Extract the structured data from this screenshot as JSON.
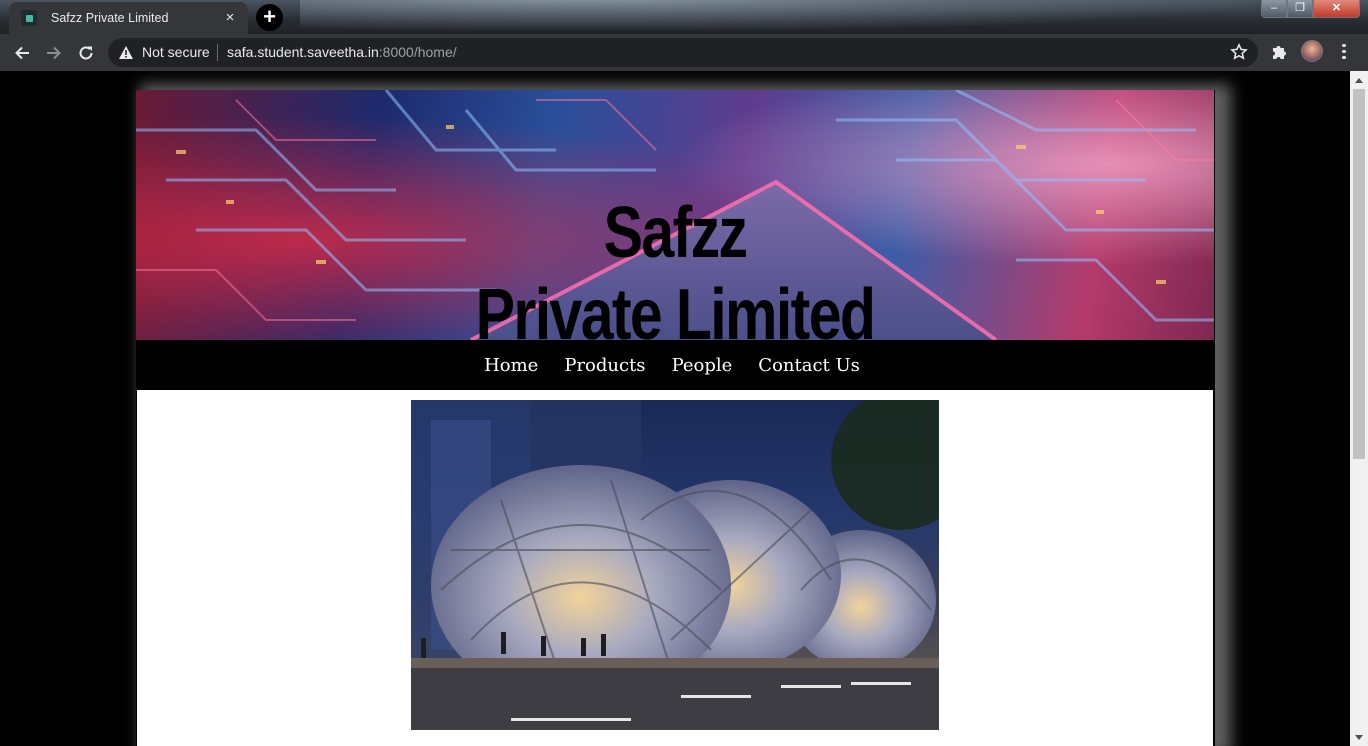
{
  "browser": {
    "tab_title": "Safzz Private Limited",
    "tab_close": "×",
    "new_tab": "+",
    "security_label": "Not secure",
    "url_host": "safa.student.saveetha.in",
    "url_rest": ":8000/home/",
    "window_controls": {
      "minimize": "–",
      "maximize": "❐",
      "close": "✕"
    }
  },
  "site": {
    "brand_line1": "Safzz",
    "brand_line2": "Private Limited",
    "nav": [
      "Home",
      "Products",
      "People",
      "Contact Us"
    ]
  },
  "colors": {
    "chrome_tab": "#35363a",
    "omnibox": "#202124",
    "page_background": "#000000",
    "content_background": "#ffffff"
  },
  "icons": [
    "back-arrow-icon",
    "forward-arrow-icon",
    "reload-icon",
    "warning-icon",
    "star-icon",
    "puzzle-icon",
    "kebab-menu-icon"
  ]
}
